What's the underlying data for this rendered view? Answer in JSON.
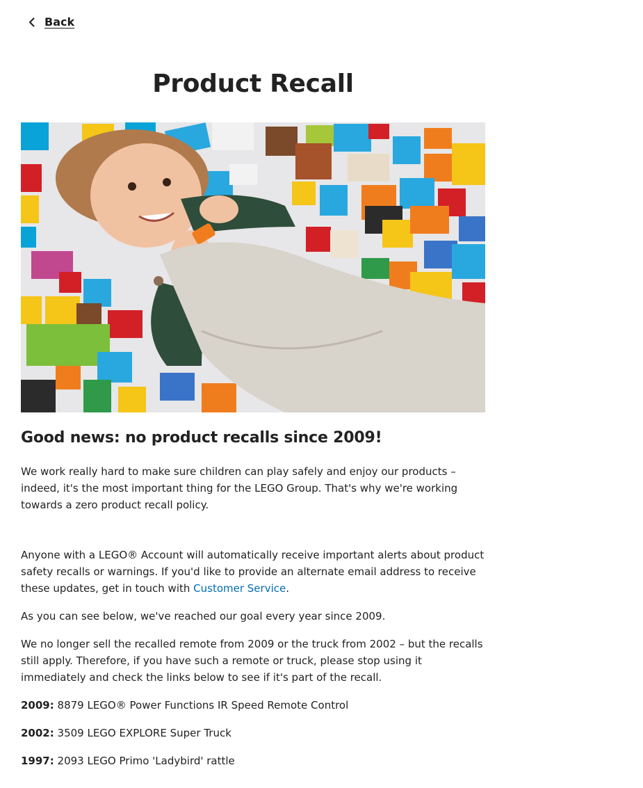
{
  "nav": {
    "back_label": "Back"
  },
  "page": {
    "title": "Product Recall"
  },
  "hero_image": {
    "subject": "child-lying-on-building-bricks"
  },
  "content": {
    "heading": "Good news: no product recalls since 2009!",
    "intro": "We work really hard to make sure children can play safely and enjoy our products – indeed, it's the most important thing for the LEGO Group. That's why we're working towards a zero product recall policy.",
    "account_text_before": "Anyone with a LEGO® Account will automatically receive important alerts about product safety recalls or warnings. If you'd like to provide an alternate email address to receive these updates, get in touch with ",
    "customer_service_link": "Customer Service",
    "account_text_after": ".",
    "goal_text": "As you can see below, we've reached our goal every year since 2009.",
    "no_longer_text": "We no longer sell the recalled remote from 2009 or the truck from 2002 – but the recalls still apply. Therefore, if you have such a remote or truck, please stop using it immediately and check the links below to see if it's part of the recall.",
    "recalls": [
      {
        "year": "2009:",
        "product": "8879 LEGO® Power Functions IR Speed Remote Control"
      },
      {
        "year": "2002:",
        "product": "3509 LEGO EXPLORE Super Truck"
      },
      {
        "year": "1997:",
        "product": "2093 LEGO Primo 'Ladybird' rattle"
      }
    ]
  },
  "colors": {
    "link": "#006cb7",
    "text": "#1c1c1c"
  }
}
